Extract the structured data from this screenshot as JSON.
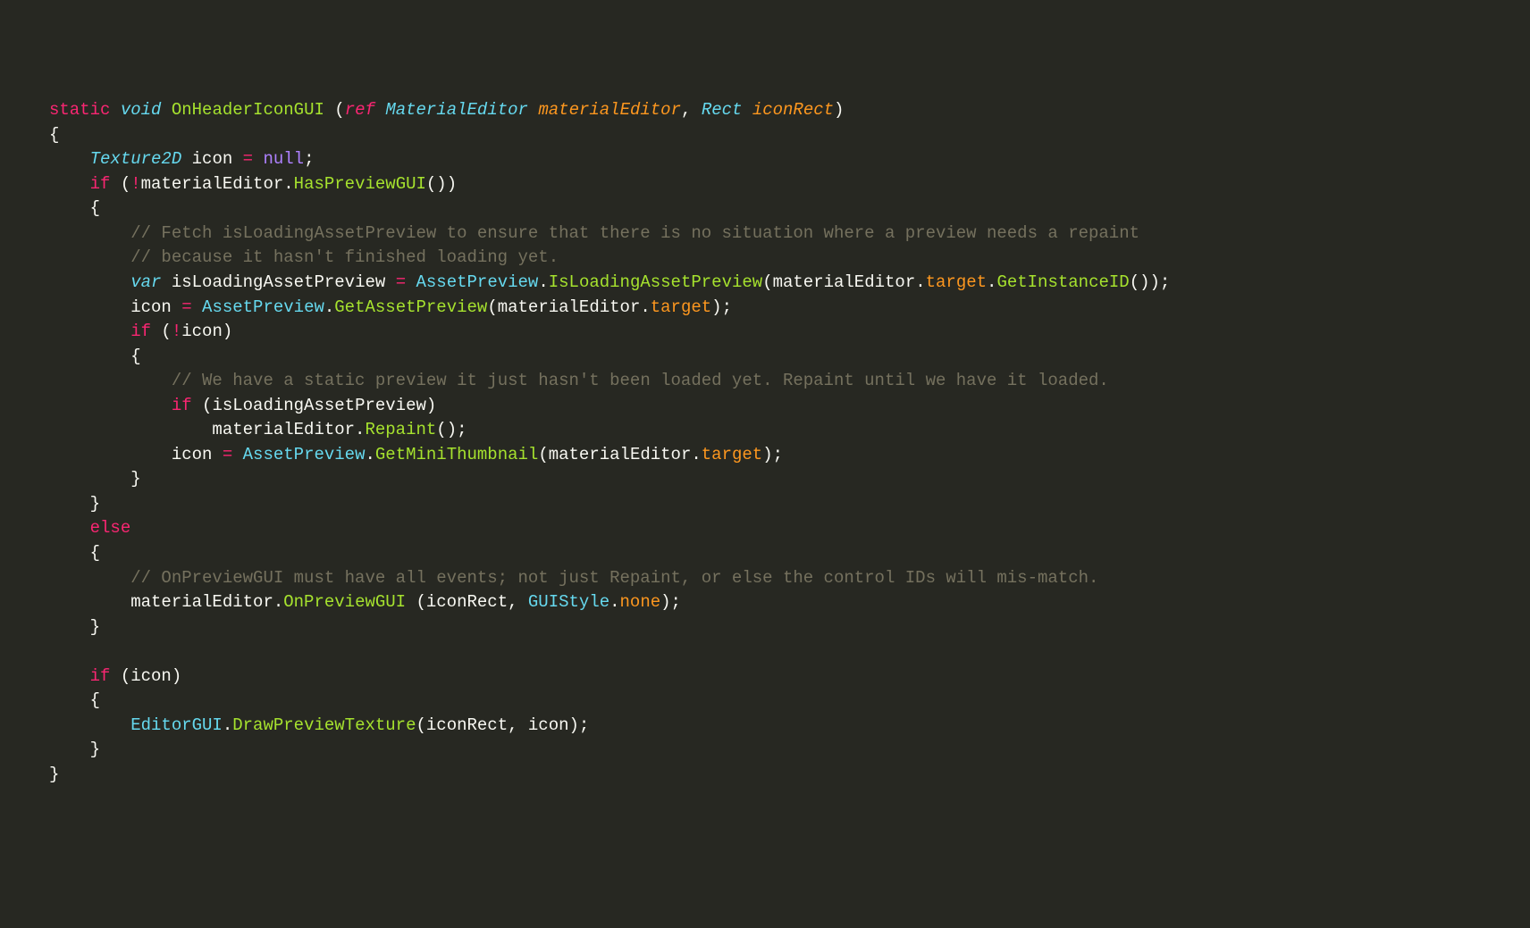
{
  "code": {
    "line0": {
      "t0": "static",
      "t1": " ",
      "t2": "void",
      "t3": " ",
      "t4": "OnHeaderIconGUI",
      "t5": " (",
      "t6": "ref",
      "t7": " ",
      "t8": "MaterialEditor",
      "t9": " ",
      "t10": "materialEditor",
      "t11": ", ",
      "t12": "Rect",
      "t13": " ",
      "t14": "iconRect",
      "t15": ")"
    },
    "line1": {
      "t0": "{"
    },
    "line2": {
      "t0": "    ",
      "t1": "Texture2D",
      "t2": " icon ",
      "t3": "=",
      "t4": " ",
      "t5": "null",
      "t6": ";"
    },
    "line3": {
      "t0": "    ",
      "t1": "if",
      "t2": " (",
      "t3": "!",
      "t4": "materialEditor.",
      "t5": "HasPreviewGUI",
      "t6": "())"
    },
    "line4": {
      "t0": "    {"
    },
    "line5": {
      "t0": "        ",
      "t1": "// Fetch isLoadingAssetPreview to ensure that there is no situation where a preview needs a repaint"
    },
    "line6": {
      "t0": "        ",
      "t1": "// because it hasn't finished loading yet."
    },
    "line7": {
      "t0": "        ",
      "t1": "var",
      "t2": " isLoadingAssetPreview ",
      "t3": "=",
      "t4": " ",
      "t5": "AssetPreview",
      "t6": ".",
      "t7": "IsLoadingAssetPreview",
      "t8": "(materialEditor.",
      "t9": "target",
      "t10": ".",
      "t11": "GetInstanceID",
      "t12": "());"
    },
    "line8": {
      "t0": "        icon ",
      "t1": "=",
      "t2": " ",
      "t3": "AssetPreview",
      "t4": ".",
      "t5": "GetAssetPreview",
      "t6": "(materialEditor.",
      "t7": "target",
      "t8": ");"
    },
    "line9": {
      "t0": "        ",
      "t1": "if",
      "t2": " (",
      "t3": "!",
      "t4": "icon)"
    },
    "line10": {
      "t0": "        {"
    },
    "line11": {
      "t0": "            ",
      "t1": "// We have a static preview it just hasn't been loaded yet. Repaint until we have it loaded."
    },
    "line12": {
      "t0": "            ",
      "t1": "if",
      "t2": " (isLoadingAssetPreview)"
    },
    "line13": {
      "t0": "                materialEditor.",
      "t1": "Repaint",
      "t2": "();"
    },
    "line14": {
      "t0": "            icon ",
      "t1": "=",
      "t2": " ",
      "t3": "AssetPreview",
      "t4": ".",
      "t5": "GetMiniThumbnail",
      "t6": "(materialEditor.",
      "t7": "target",
      "t8": ");"
    },
    "line15": {
      "t0": "        }"
    },
    "line16": {
      "t0": "    }"
    },
    "line17": {
      "t0": "    ",
      "t1": "else"
    },
    "line18": {
      "t0": "    {"
    },
    "line19": {
      "t0": "        ",
      "t1": "// OnPreviewGUI must have all events; not just Repaint, or else the control IDs will mis-match."
    },
    "line20": {
      "t0": "        materialEditor.",
      "t1": "OnPreviewGUI",
      "t2": " (iconRect, ",
      "t3": "GUIStyle",
      "t4": ".",
      "t5": "none",
      "t6": ");"
    },
    "line21": {
      "t0": "    }"
    },
    "line22": {
      "t0": ""
    },
    "line23": {
      "t0": "    ",
      "t1": "if",
      "t2": " (icon)"
    },
    "line24": {
      "t0": "    {"
    },
    "line25": {
      "t0": "        ",
      "t1": "EditorGUI",
      "t2": ".",
      "t3": "DrawPreviewTexture",
      "t4": "(iconRect, icon);"
    },
    "line26": {
      "t0": "    }"
    },
    "line27": {
      "t0": "}"
    }
  }
}
